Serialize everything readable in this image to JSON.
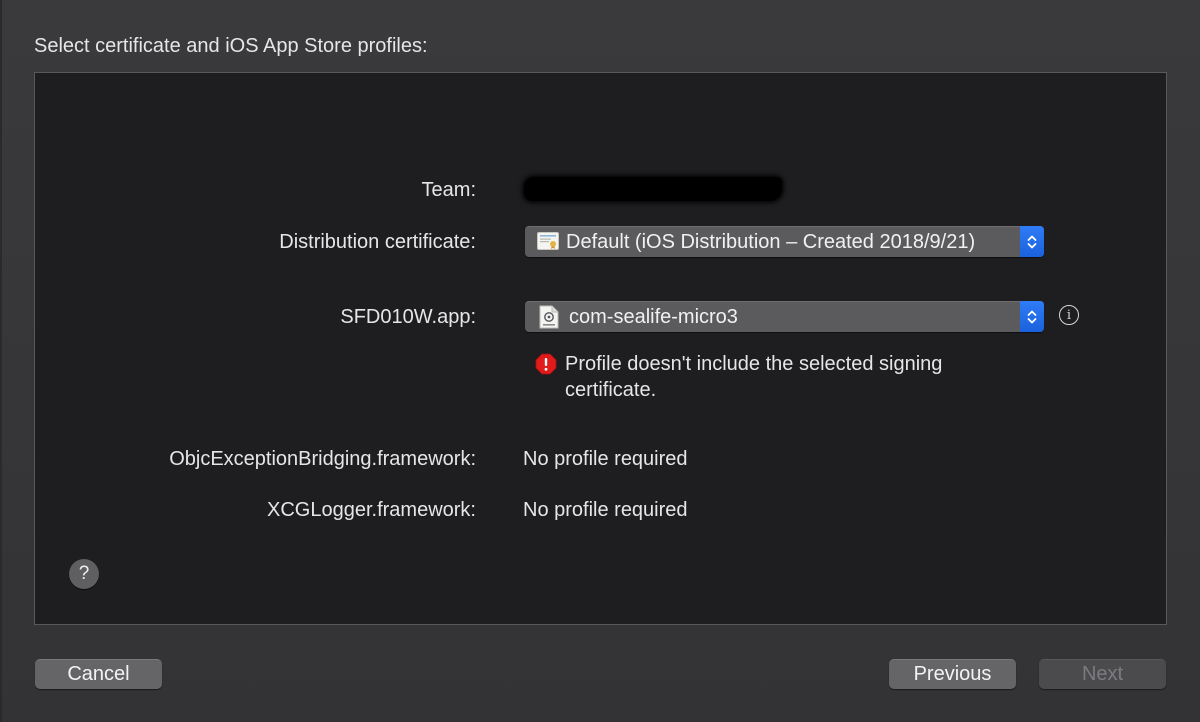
{
  "dialog": {
    "heading": "Select certificate and iOS App Store profiles:"
  },
  "fields": {
    "team": {
      "label": "Team:"
    },
    "distribution_certificate": {
      "label": "Distribution certificate:",
      "value": "Default (iOS Distribution – Created 2018/9/21)"
    },
    "app": {
      "label": "SFD010W.app:",
      "value": "com-sealife-micro3",
      "error": "Profile doesn't include the selected signing certificate."
    },
    "framework_1": {
      "label": "ObjcExceptionBridging.framework:",
      "value": "No profile required"
    },
    "framework_2": {
      "label": "XCGLogger.framework:",
      "value": "No profile required"
    }
  },
  "buttons": {
    "help": "?",
    "info": "i",
    "cancel": "Cancel",
    "previous": "Previous",
    "next": "Next"
  },
  "colors": {
    "accent": "#1a62dd",
    "error": "#e01b1b"
  }
}
